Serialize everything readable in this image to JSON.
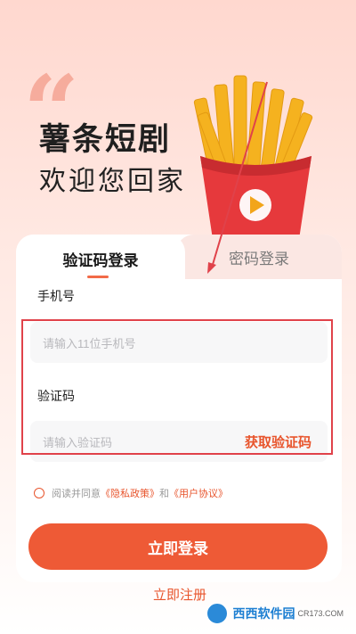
{
  "hero": {
    "title": "薯条短剧",
    "subtitle": "欢迎您回家"
  },
  "tabs": {
    "sms_login": "验证码登录",
    "password_login": "密码登录"
  },
  "form": {
    "phone_label": "手机号",
    "phone_placeholder": "请输入11位手机号",
    "code_label": "验证码",
    "code_placeholder": "请输入验证码",
    "get_code": "获取验证码"
  },
  "agreement": {
    "prefix": "阅读并同意",
    "privacy": "《隐私政策》",
    "and": "和",
    "user_agreement": "《用户协议》"
  },
  "buttons": {
    "login": "立即登录",
    "register": "立即注册"
  },
  "watermark": {
    "brand": "西西软件园",
    "domain": "CR173.COM"
  },
  "colors": {
    "accent": "#ee5a36",
    "annotation": "#e0424a"
  }
}
